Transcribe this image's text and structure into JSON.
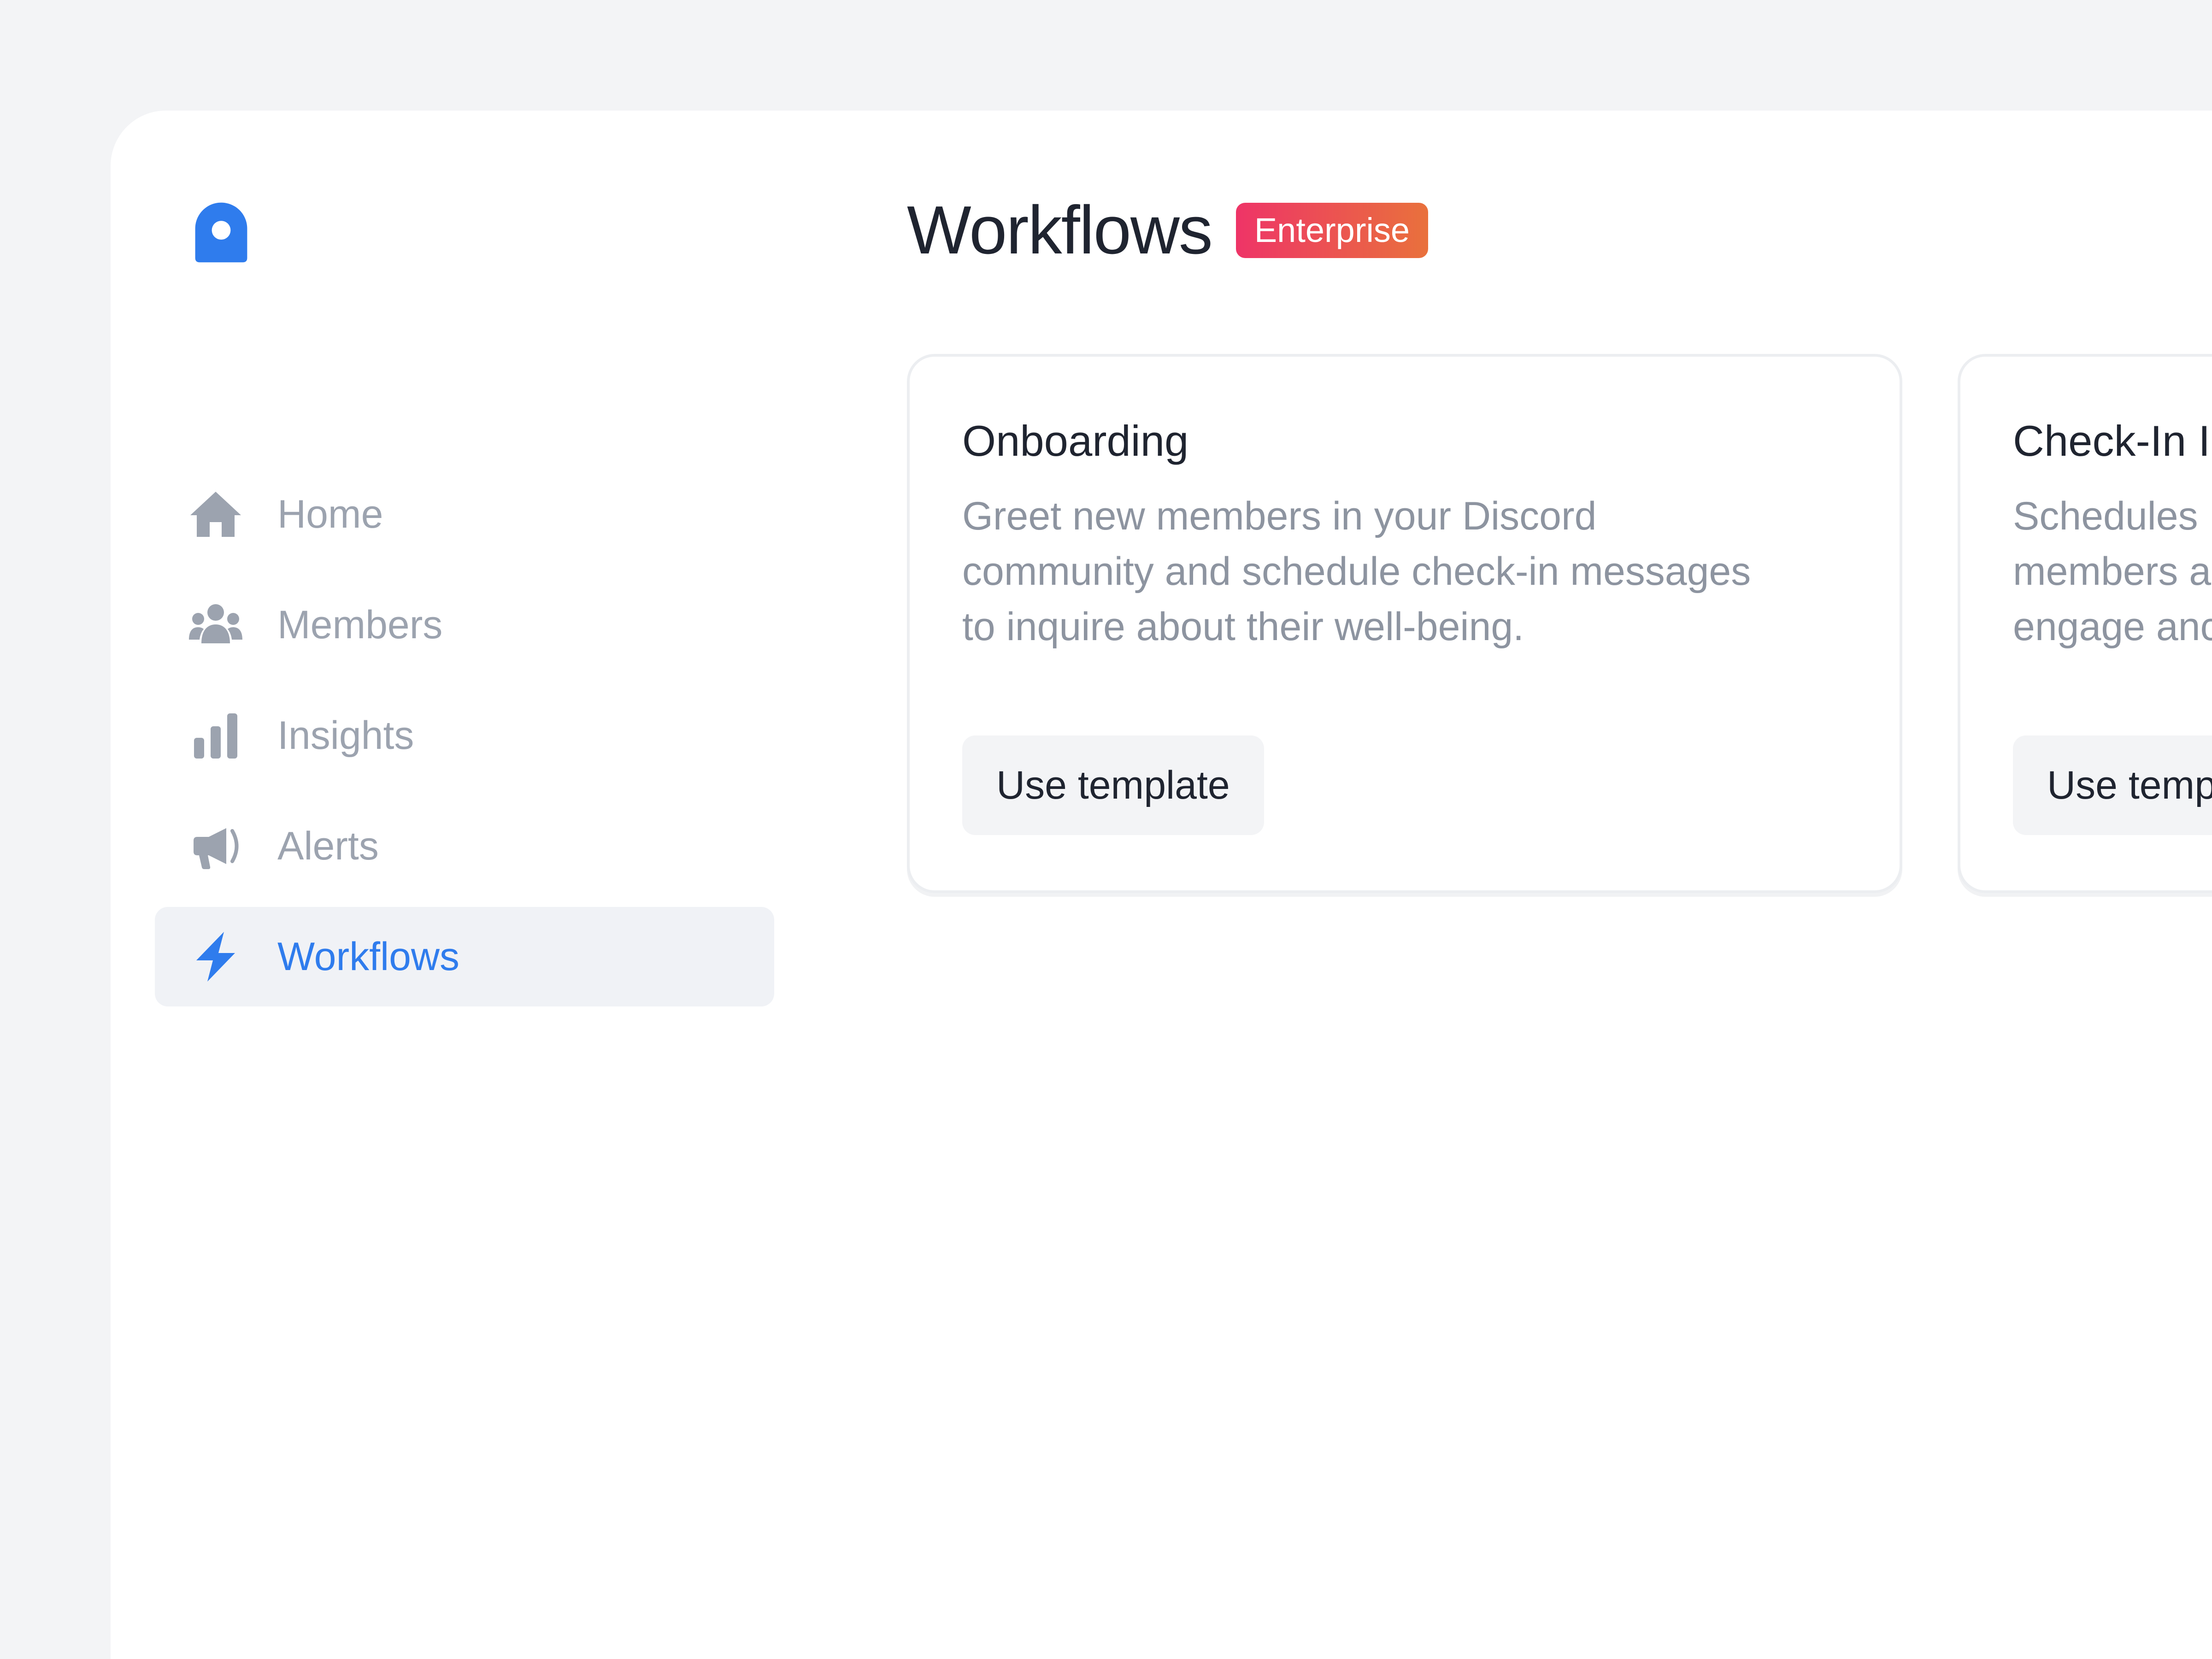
{
  "sidebar": {
    "logo_icon": "app-logo-icon",
    "items": [
      {
        "label": "Home",
        "icon": "home-icon",
        "active": false
      },
      {
        "label": "Members",
        "icon": "members-icon",
        "active": false
      },
      {
        "label": "Insights",
        "icon": "bar-chart-icon",
        "active": false
      },
      {
        "label": "Alerts",
        "icon": "megaphone-icon",
        "active": false
      },
      {
        "label": "Workflows",
        "icon": "lightning-bolt-icon",
        "active": true
      }
    ]
  },
  "header": {
    "title": "Workflows",
    "badge": "Enterprise"
  },
  "cards": [
    {
      "title": "Onboarding",
      "description": "Greet new members in your Discord\ncommunity and schedule check-in messages\nto inquire about their well-being.",
      "button_label": "Use template"
    },
    {
      "title": "Check-In I",
      "description": "Schedules\nmembers a\nengage anc",
      "button_label": "Use temp"
    }
  ],
  "colors": {
    "accent": "#2f7ced",
    "inactive_text": "#9ca3af",
    "badge_gradient_start": "#ee3467",
    "badge_gradient_end": "#e9713c",
    "background": "#f3f4f6"
  }
}
